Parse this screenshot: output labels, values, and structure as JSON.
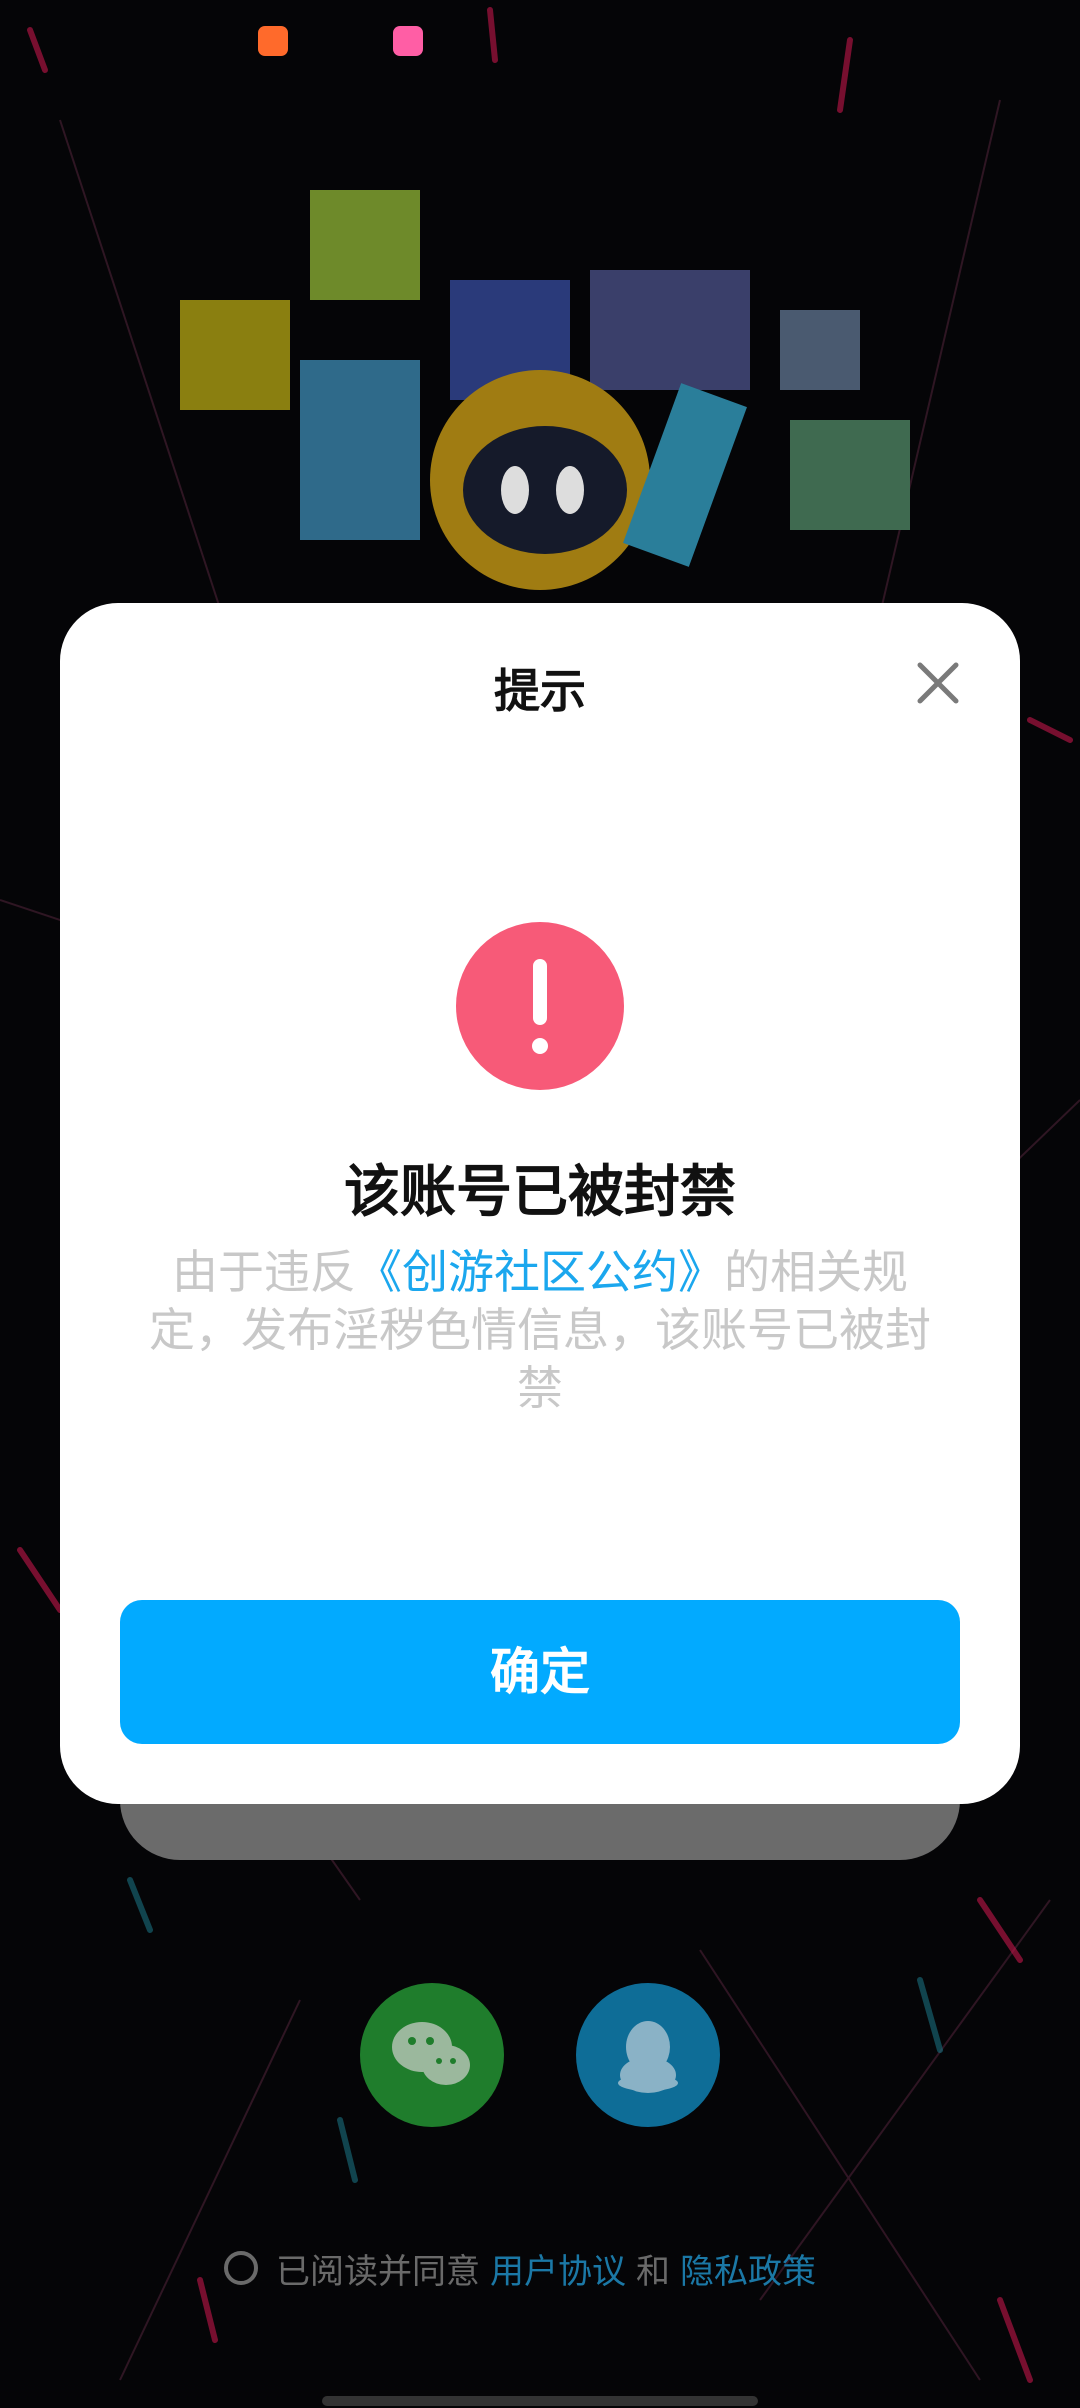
{
  "status_bar": {
    "icons": [
      "app-notification-icon",
      "app-notification-icon"
    ]
  },
  "dialog": {
    "title": "提示",
    "heading": "该账号已被封禁",
    "message_prefix": "由于违反",
    "policy_link": "《创游社区公约》",
    "message_suffix": "的相关规定，发布淫秽色情信息，该账号已被封禁",
    "confirm_label": "确定",
    "close_icon": "close-icon",
    "warning_icon": "exclamation-icon"
  },
  "login": {
    "wechat_icon": "wechat-icon",
    "qq_icon": "qq-icon"
  },
  "agreement": {
    "prefix": "已阅读并同意",
    "user_agreement": "用户协议",
    "and": "和",
    "privacy_policy": "隐私政策"
  },
  "colors": {
    "accent": "#02aaff",
    "warning": "#f75a78",
    "link": "#1ba7ee"
  }
}
